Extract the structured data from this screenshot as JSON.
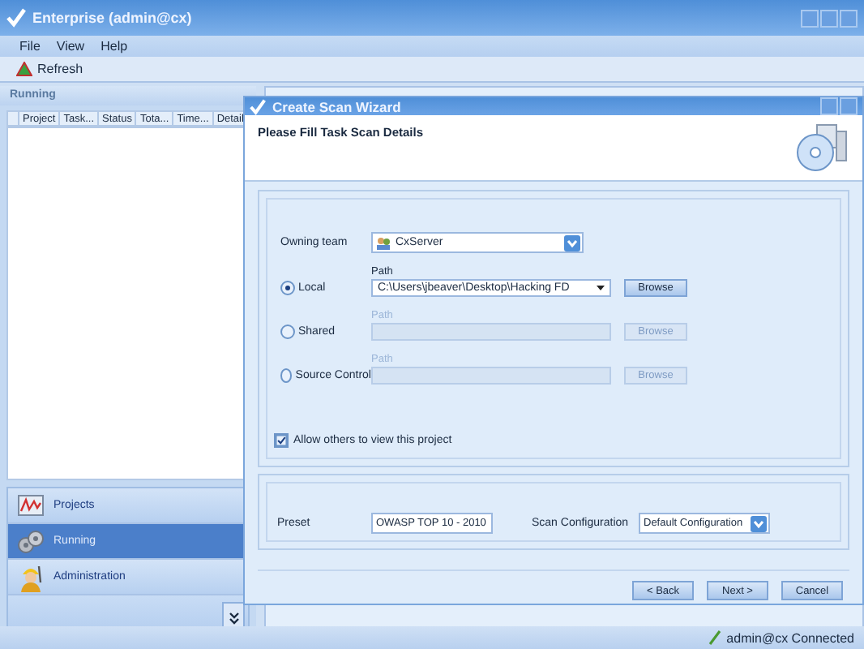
{
  "window": {
    "title": "Enterprise (admin@cx)"
  },
  "menu": [
    "File",
    "View",
    "Help"
  ],
  "toolbar": {
    "refresh": "Refresh"
  },
  "running_panel": {
    "title": "Running",
    "columns": [
      "Project",
      "Task...",
      "Status",
      "Tota...",
      "Time...",
      "Detail"
    ]
  },
  "nav": [
    {
      "label": "Projects",
      "selected": false,
      "kind": "chart"
    },
    {
      "label": "Running",
      "selected": true,
      "kind": "gears"
    },
    {
      "label": "Administration",
      "selected": false,
      "kind": "worker"
    }
  ],
  "wizard": {
    "title": "Create Scan Wizard",
    "heading": "Please Fill Task Scan Details",
    "owning_team": {
      "label": "Owning team",
      "value": "CxServer"
    },
    "sources": [
      {
        "label": "Local",
        "selected": true,
        "path_label": "Path",
        "path_value": "C:\\Users\\jbeaver\\Desktop\\Hacking FD",
        "browse": "Browse",
        "disabled": false
      },
      {
        "label": "Shared",
        "selected": false,
        "path_label": "Path",
        "browse": "Browse",
        "disabled": true
      },
      {
        "label": "Source Control",
        "selected": false,
        "path_label": "Path",
        "browse": "Browse",
        "disabled": true
      }
    ],
    "allow_others": {
      "label": "Allow others to view this project",
      "checked": true
    },
    "preset": {
      "label": "Preset",
      "value": "OWASP TOP 10 - 2010"
    },
    "scan_configuration": {
      "label": "Scan Configuration",
      "value": "Default Configuration"
    },
    "buttons": [
      "< Back",
      "Next >",
      "Cancel"
    ]
  },
  "status_bar": {
    "text": "admin@cx Connected"
  }
}
